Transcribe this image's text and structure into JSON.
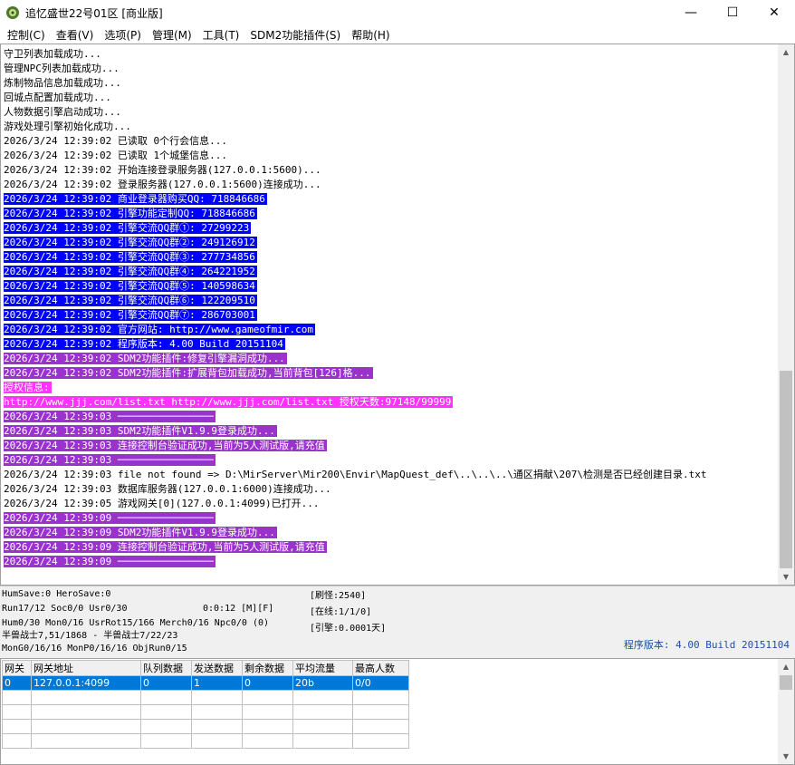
{
  "window": {
    "title": "追忆盛世22号01区 [商业版]",
    "minimize": "—",
    "maximize": "☐",
    "close": "✕"
  },
  "menu": [
    "控制(C)",
    "查看(V)",
    "选项(P)",
    "管理(M)",
    "工具(T)",
    "SDM2功能插件(S)",
    "帮助(H)"
  ],
  "log": [
    {
      "text": "守卫列表加载成功...",
      "style": ""
    },
    {
      "text": "管理NPC列表加载成功...",
      "style": ""
    },
    {
      "text": "炼制物品信息加载成功...",
      "style": ""
    },
    {
      "text": "回城点配置加载成功...",
      "style": ""
    },
    {
      "text": "人物数据引擎启动成功...",
      "style": ""
    },
    {
      "text": "游戏处理引擎初始化成功...",
      "style": ""
    },
    {
      "text": "2026/3/24 12:39:02 已读取 0个行会信息...",
      "style": ""
    },
    {
      "text": "2026/3/24 12:39:02 已读取 1个城堡信息...",
      "style": ""
    },
    {
      "text": "2026/3/24 12:39:02 开始连接登录服务器(127.0.0.1:5600)...",
      "style": ""
    },
    {
      "text": "2026/3/24 12:39:02 登录服务器(127.0.0.1:5600)连接成功...",
      "style": ""
    },
    {
      "text": "2026/3/24 12:39:02 商业登录器购买QQ: 718846686",
      "style": "blue"
    },
    {
      "text": "2026/3/24 12:39:02 引擎功能定制QQ: 718846686",
      "style": "blue"
    },
    {
      "text": "2026/3/24 12:39:02 引擎交流QQ群①: 27299223",
      "style": "blue"
    },
    {
      "text": "2026/3/24 12:39:02 引擎交流QQ群②: 249126912",
      "style": "blue"
    },
    {
      "text": "2026/3/24 12:39:02 引擎交流QQ群③: 277734856",
      "style": "blue"
    },
    {
      "text": "2026/3/24 12:39:02 引擎交流QQ群④: 264221952",
      "style": "blue"
    },
    {
      "text": "2026/3/24 12:39:02 引擎交流QQ群⑤: 140598634",
      "style": "blue"
    },
    {
      "text": "2026/3/24 12:39:02 引擎交流QQ群⑥: 122209510",
      "style": "blue"
    },
    {
      "text": "2026/3/24 12:39:02 引擎交流QQ群⑦: 286703001",
      "style": "blue"
    },
    {
      "text": "2026/3/24 12:39:02 官方网站: http://www.gameofmir.com",
      "style": "blue"
    },
    {
      "text": "2026/3/24 12:39:02 程序版本: 4.00 Build 20151104",
      "style": "blue"
    },
    {
      "text": "2026/3/24 12:39:02 SDM2功能插件:修复引擎漏洞成功...",
      "style": "purple"
    },
    {
      "text": "2026/3/24 12:39:02 SDM2功能插件:扩展背包加载成功,当前背包[126]格...",
      "style": "purple"
    },
    {
      "text": "授权信息:",
      "style": "magenta"
    },
    {
      "text": "http://www.jjj.com/list.txt http://www.jjj.com/list.txt 授权天数:97148/99999",
      "style": "magenta"
    },
    {
      "text": "2026/3/24 12:39:03 ────────────────",
      "style": "purple"
    },
    {
      "text": "2026/3/24 12:39:03 SDM2功能插件V1.9.9登录成功...",
      "style": "purple"
    },
    {
      "text": "2026/3/24 12:39:03 连接控制台验证成功,当前为5人测试版,请充值",
      "style": "purple"
    },
    {
      "text": "2026/3/24 12:39:03 ────────────────",
      "style": "purple"
    },
    {
      "text": "2026/3/24 12:39:03 file not found => D:\\MirServer\\Mir200\\Envir\\MapQuest_def\\..\\..\\..\\通区捐献\\207\\检测是否已经创建目录.txt",
      "style": ""
    },
    {
      "text": "2026/3/24 12:39:03 数据库服务器(127.0.0.1:6000)连接成功...",
      "style": ""
    },
    {
      "text": "2026/3/24 12:39:05 游戏网关[0](127.0.0.1:4099)已打开...",
      "style": ""
    },
    {
      "text": "2026/3/24 12:39:09 ────────────────",
      "style": "purple"
    },
    {
      "text": "2026/3/24 12:39:09 SDM2功能插件V1.9.9登录成功...",
      "style": "purple"
    },
    {
      "text": "2026/3/24 12:39:09 连接控制台验证成功,当前为5人测试版,请充值",
      "style": "purple"
    },
    {
      "text": "2026/3/24 12:39:09 ────────────────",
      "style": "purple"
    }
  ],
  "status": {
    "line1": "HumSave:0 HeroSave:0",
    "line2a": "Run17/12 Soc0/0 Usr0/30",
    "line2b": "0:0:12 [M][F]",
    "line3": "Hum0/30 Mon0/16 UsrRot15/166 Merch0/16 Npc0/0 (0)",
    "line4": "半兽战士7,51/1868 - 半兽战士7/22/23",
    "line5": "MonG0/16/16 MonP0/16/16 ObjRun0/15",
    "refresh": "[刷怪:2540]",
    "online": "[在线:1/1/0]",
    "engine": "[引擎:0.0001天]",
    "version": "程序版本: 4.00 Build 20151104"
  },
  "gateway_table": {
    "headers": [
      "网关",
      "网关地址",
      "队列数据",
      "发送数据",
      "剩余数据",
      "平均流量",
      "最高人数"
    ],
    "rows": [
      [
        "0",
        "127.0.0.1:4099",
        "0",
        "1",
        "0",
        "20b",
        "0/0"
      ]
    ]
  }
}
